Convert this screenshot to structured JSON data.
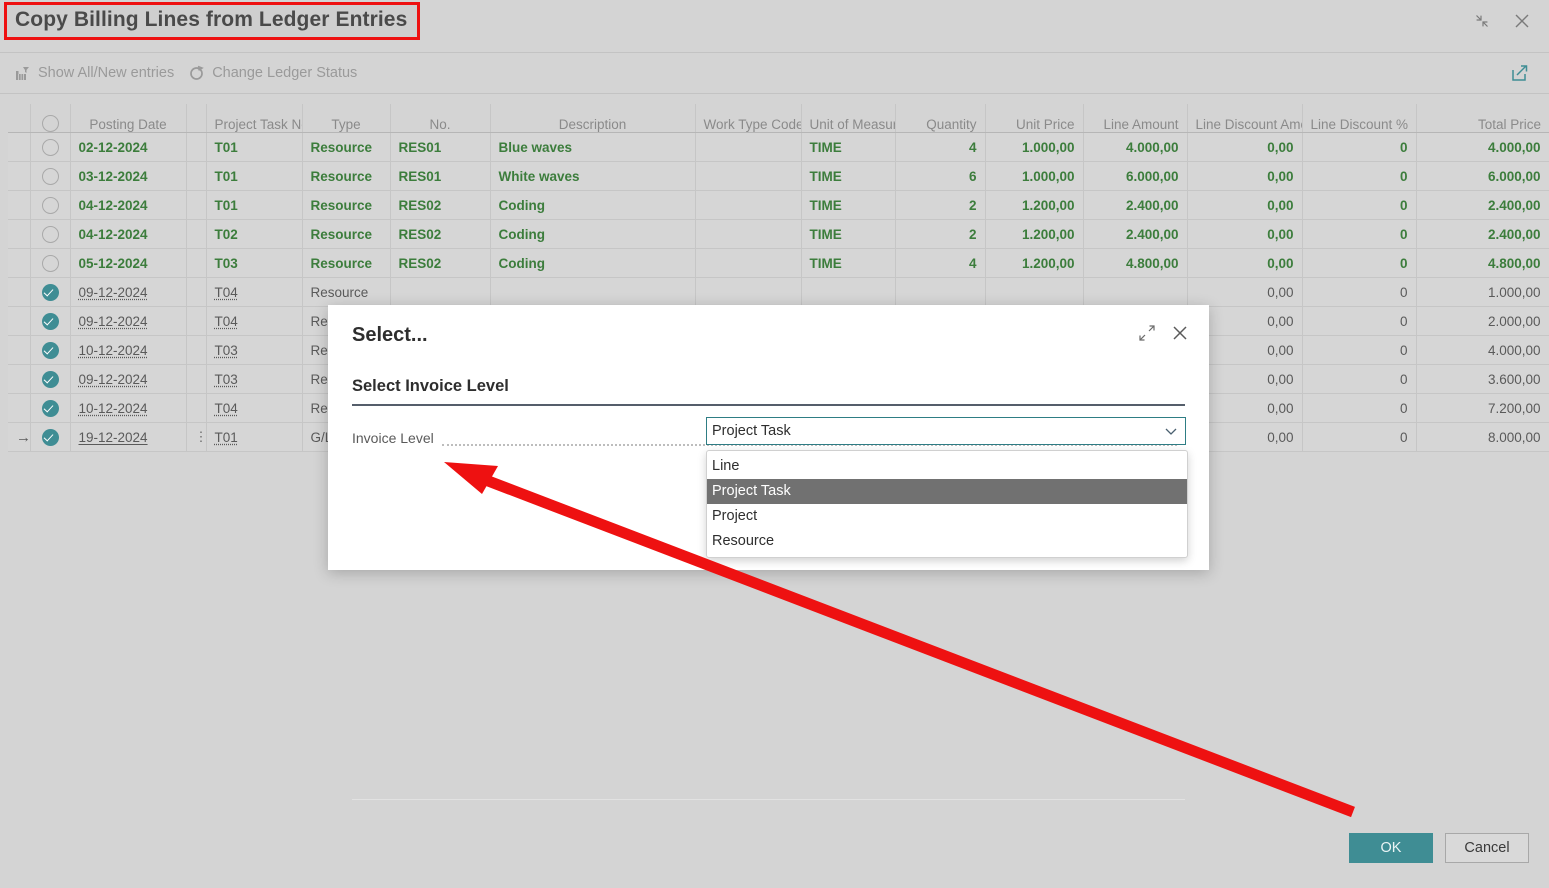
{
  "window": {
    "title": "Copy Billing Lines from Ledger Entries",
    "collapse_icon": "collapse-icon",
    "close_icon": "close-icon"
  },
  "toolbar": {
    "items": [
      {
        "label": "Show All/New entries",
        "icon": "filter-entries-icon"
      },
      {
        "label": "Change Ledger Status",
        "icon": "refresh-status-icon"
      }
    ],
    "share_icon": "share-icon"
  },
  "grid": {
    "columns": [
      {
        "key": "sel",
        "label": ""
      },
      {
        "key": "posting",
        "label": "Posting Date"
      },
      {
        "key": "dots",
        "label": ""
      },
      {
        "key": "task",
        "label": "Project Task No."
      },
      {
        "key": "type",
        "label": "Type"
      },
      {
        "key": "no",
        "label": "No."
      },
      {
        "key": "desc",
        "label": "Description"
      },
      {
        "key": "worktype",
        "label": "Work Type Code"
      },
      {
        "key": "uom",
        "label": "Unit of Measure Code"
      },
      {
        "key": "qty",
        "label": "Quantity"
      },
      {
        "key": "unitprice",
        "label": "Unit Price"
      },
      {
        "key": "lineamount",
        "label": "Line Amount"
      },
      {
        "key": "discamount",
        "label": "Line Discount Amount"
      },
      {
        "key": "discpct",
        "label": "Line Discount %"
      },
      {
        "key": "total",
        "label": "Total Price"
      }
    ],
    "rows": [
      {
        "state": "new",
        "selected": false,
        "current": false,
        "posting": "02-12-2024",
        "task": "T01",
        "type": "Resource",
        "no": "RES01",
        "desc": "Blue waves",
        "worktype": "",
        "uom": "TIME",
        "qty": "4",
        "unitprice": "1.000,00",
        "lineamount": "4.000,00",
        "discamount": "0,00",
        "discpct": "0",
        "total": "4.000,00"
      },
      {
        "state": "new",
        "selected": false,
        "current": false,
        "posting": "03-12-2024",
        "task": "T01",
        "type": "Resource",
        "no": "RES01",
        "desc": "White waves",
        "worktype": "",
        "uom": "TIME",
        "qty": "6",
        "unitprice": "1.000,00",
        "lineamount": "6.000,00",
        "discamount": "0,00",
        "discpct": "0",
        "total": "6.000,00"
      },
      {
        "state": "new",
        "selected": false,
        "current": false,
        "posting": "04-12-2024",
        "task": "T01",
        "type": "Resource",
        "no": "RES02",
        "desc": "Coding",
        "worktype": "",
        "uom": "TIME",
        "qty": "2",
        "unitprice": "1.200,00",
        "lineamount": "2.400,00",
        "discamount": "0,00",
        "discpct": "0",
        "total": "2.400,00"
      },
      {
        "state": "new",
        "selected": false,
        "current": false,
        "posting": "04-12-2024",
        "task": "T02",
        "type": "Resource",
        "no": "RES02",
        "desc": "Coding",
        "worktype": "",
        "uom": "TIME",
        "qty": "2",
        "unitprice": "1.200,00",
        "lineamount": "2.400,00",
        "discamount": "0,00",
        "discpct": "0",
        "total": "2.400,00"
      },
      {
        "state": "new",
        "selected": false,
        "current": false,
        "posting": "05-12-2024",
        "task": "T03",
        "type": "Resource",
        "no": "RES02",
        "desc": "Coding",
        "worktype": "",
        "uom": "TIME",
        "qty": "4",
        "unitprice": "1.200,00",
        "lineamount": "4.800,00",
        "discamount": "0,00",
        "discpct": "0",
        "total": "4.800,00"
      },
      {
        "state": "old",
        "selected": true,
        "current": false,
        "posting": "09-12-2024",
        "task": "T04",
        "type": "Resource",
        "no": "",
        "desc": "",
        "worktype": "",
        "uom": "",
        "qty": "",
        "unitprice": "",
        "lineamount": "",
        "discamount": "0,00",
        "discpct": "0",
        "total": "1.000,00"
      },
      {
        "state": "old",
        "selected": true,
        "current": false,
        "posting": "09-12-2024",
        "task": "T04",
        "type": "Resource",
        "no": "",
        "desc": "",
        "worktype": "",
        "uom": "",
        "qty": "",
        "unitprice": "",
        "lineamount": "",
        "discamount": "0,00",
        "discpct": "0",
        "total": "2.000,00"
      },
      {
        "state": "old",
        "selected": true,
        "current": false,
        "posting": "10-12-2024",
        "task": "T03",
        "type": "Resource",
        "no": "",
        "desc": "",
        "worktype": "",
        "uom": "",
        "qty": "",
        "unitprice": "",
        "lineamount": "",
        "discamount": "0,00",
        "discpct": "0",
        "total": "4.000,00"
      },
      {
        "state": "old",
        "selected": true,
        "current": false,
        "posting": "09-12-2024",
        "task": "T03",
        "type": "Resource",
        "no": "",
        "desc": "",
        "worktype": "",
        "uom": "",
        "qty": "",
        "unitprice": "",
        "lineamount": "",
        "discamount": "0,00",
        "discpct": "0",
        "total": "3.600,00"
      },
      {
        "state": "old",
        "selected": true,
        "current": false,
        "posting": "10-12-2024",
        "task": "T04",
        "type": "Resource",
        "no": "",
        "desc": "",
        "worktype": "",
        "uom": "",
        "qty": "",
        "unitprice": "",
        "lineamount": "",
        "discamount": "0,00",
        "discpct": "0",
        "total": "7.200,00"
      },
      {
        "state": "old",
        "selected": true,
        "current": true,
        "posting": "19-12-2024",
        "task": "T01",
        "type": "G/L A",
        "no": "",
        "desc": "",
        "worktype": "",
        "uom": "",
        "qty": "",
        "unitprice": "",
        "lineamount": "",
        "discamount": "0,00",
        "discpct": "0",
        "total": "8.000,00"
      }
    ]
  },
  "dialog": {
    "title": "Select...",
    "section_title": "Select Invoice Level",
    "field_label": "Invoice Level",
    "field_value": "Project Task",
    "expand_icon": "expand-icon",
    "close_icon": "close-icon",
    "caret_icon": "chevron-down-icon",
    "options": [
      {
        "label": "Line",
        "selected": false
      },
      {
        "label": "Project Task",
        "selected": true
      },
      {
        "label": "Project",
        "selected": false
      },
      {
        "label": "Resource",
        "selected": false
      }
    ]
  },
  "footer": {
    "ok_label": "OK",
    "cancel_label": "Cancel"
  },
  "colors": {
    "accent_teal": "#3f8d94",
    "new_row_green": "#3c7d3c",
    "annotation_red": "#ee1111",
    "page_bg": "#d4d4d4"
  }
}
